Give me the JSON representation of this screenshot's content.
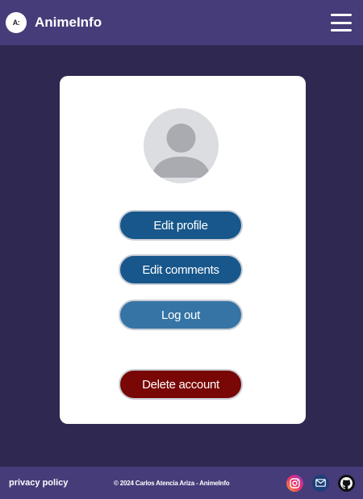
{
  "header": {
    "logo_text": "A:",
    "brand": "AnimeInfo",
    "menu_icon": "hamburger-menu-icon"
  },
  "profile": {
    "avatar_icon": "user-placeholder-icon",
    "buttons": {
      "edit_profile": "Edit profile",
      "edit_comments": "Edit comments",
      "logout": "Log out",
      "delete_account": "Delete account"
    }
  },
  "footer": {
    "privacy": "privacy policy",
    "copyright": "© 2024 Carlos Atencia Ariza - AnimeInfo",
    "socials": [
      "instagram-icon",
      "mail-icon",
      "github-icon"
    ]
  },
  "colors": {
    "background": "#2f2850",
    "bar": "#463c79",
    "primary_button": "#17578b",
    "logout_button": "#3574a5",
    "danger_button": "#780706"
  }
}
